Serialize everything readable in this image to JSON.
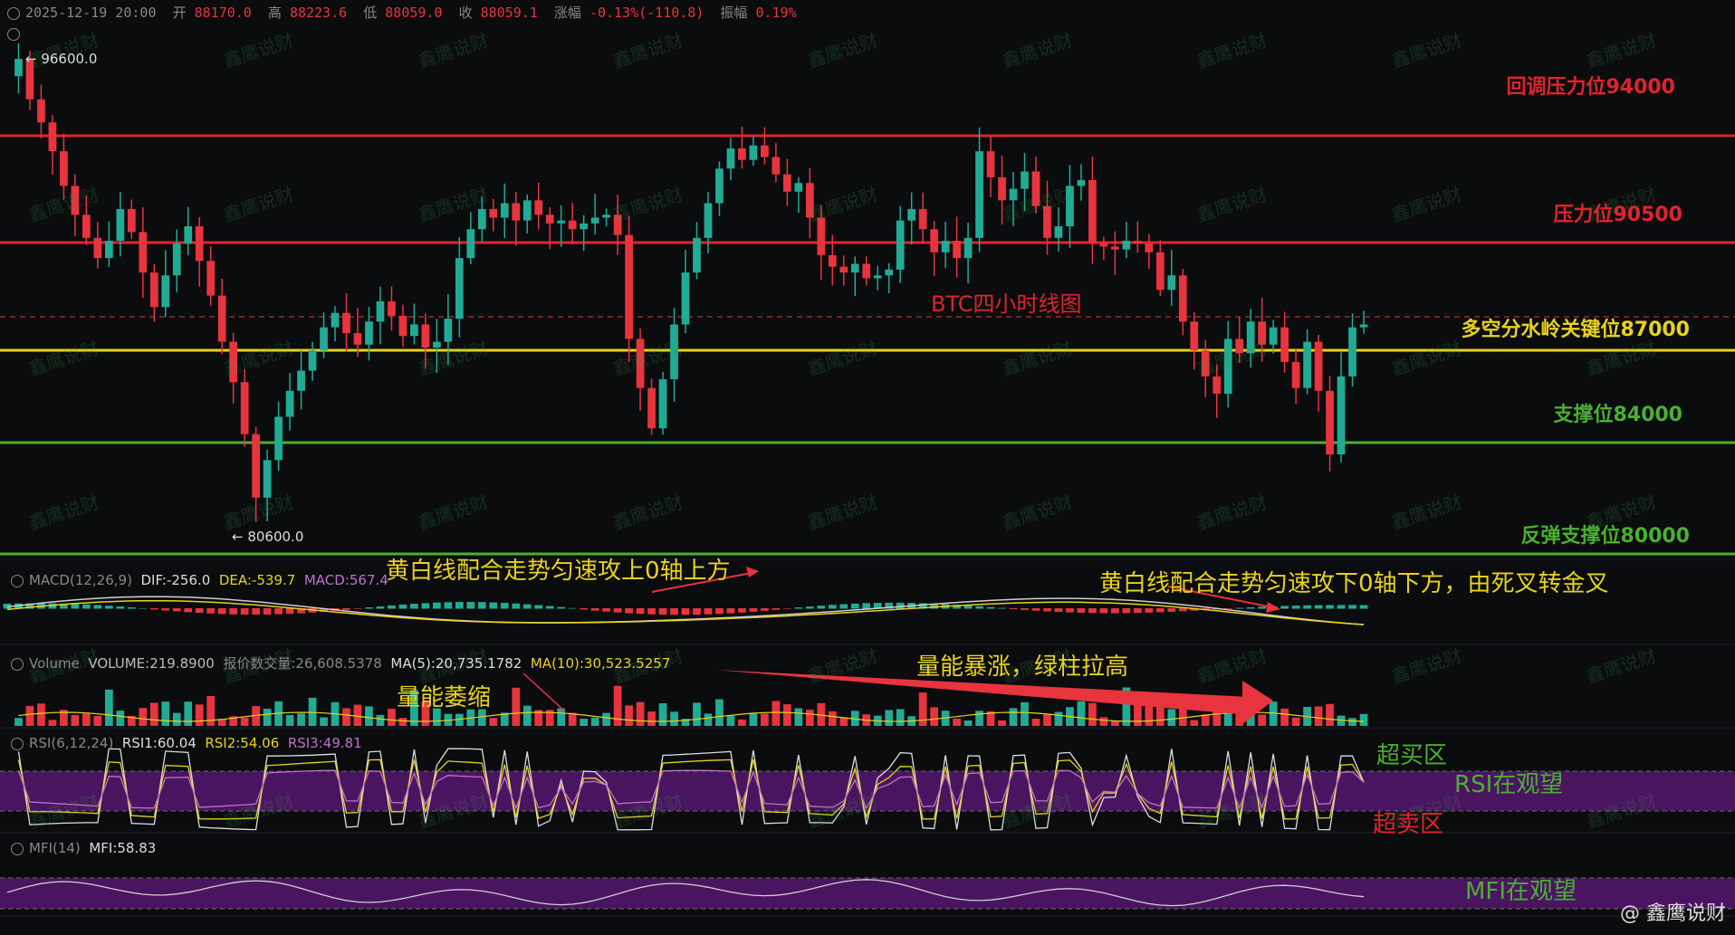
{
  "header": {
    "datetime": "2025-12-19 20:00",
    "open_label": "开",
    "open": "88170.0",
    "high_label": "高",
    "high": "88223.6",
    "low_label": "低",
    "low": "88059.0",
    "close_label": "收",
    "close": "88059.1",
    "change_label": "涨幅",
    "change": "-0.13%(-110.8)",
    "amplitude_label": "振幅",
    "amplitude": "0.19%"
  },
  "price_marks": {
    "high": "← 96600.0",
    "low": "← 80600.0"
  },
  "levels": [
    {
      "label": "回调压力位94000",
      "price": 94000,
      "color": "#e0242c",
      "style": "solid"
    },
    {
      "label": "压力位90500",
      "price": 90500,
      "color": "#e0242c",
      "style": "solid"
    },
    {
      "label": "多空分水岭关键位87000",
      "price": 87000,
      "color": "#e8d21d",
      "style": "solid"
    },
    {
      "label": "支撑位84000",
      "price": 84000,
      "color": "#49b030",
      "style": "solid"
    },
    {
      "label": "反弹支撑位80000",
      "price": 80000,
      "color": "#49b030",
      "style": "solid"
    }
  ],
  "chart_title": "BTC四小时线图",
  "macd": {
    "label": "MACD(12,26,9)",
    "dif": "DIF:-256.0",
    "dea": "DEA:-539.7",
    "macd": "MACD:567.4"
  },
  "volume": {
    "label": "Volume",
    "vol": "VOLUME:219.8900",
    "quote": "报价数交量:26,608.5378",
    "ma5": "MA(5):20,735.1782",
    "ma10": "MA(10):30,523.5257"
  },
  "rsi": {
    "label": "RSI(6,12,24)",
    "rsi1": "RSI1:60.04",
    "rsi2": "RSI2:54.06",
    "rsi3": "RSI3:49.81"
  },
  "mfi": {
    "label": "MFI(14)",
    "value": "MFI:58.83"
  },
  "annotations": {
    "macd_left": "黄白线配合走势匀速攻上0轴上方",
    "macd_right": "黄白线配合走势匀速攻下0轴下方，由死叉转金叉",
    "vol_left": "量能萎缩",
    "vol_right": "量能暴涨，绿柱拉高",
    "overbought": "超买区",
    "rsi_watch": "RSI在观望",
    "oversold": "超卖区",
    "mfi_watch": "MFI在观望"
  },
  "watermark": "鑫鹰说财",
  "source_tag": "@ 鑫鹰说财",
  "colors": {
    "up": "#22ab94",
    "down": "#e8343e",
    "bg": "#0b0c0e",
    "band": "#4a1560"
  },
  "chart_data": {
    "type": "candlestick",
    "title": "BTC四小时线图",
    "ylim": [
      79500,
      97500
    ],
    "close_path": [
      95800,
      96400,
      95000,
      94200,
      93200,
      92000,
      91000,
      90200,
      89500,
      90100,
      91200,
      90400,
      89000,
      87800,
      88900,
      90000,
      90600,
      89400,
      88200,
      86600,
      85200,
      83400,
      81200,
      82500,
      84000,
      84900,
      85600,
      86300,
      87100,
      87600,
      86900,
      86500,
      87300,
      88000,
      87500,
      86800,
      87200,
      86400,
      86600,
      87400,
      89500,
      90500,
      91200,
      90900,
      91400,
      90800,
      91500,
      91000,
      90700,
      90800,
      90500,
      90700,
      90900,
      91000,
      90300,
      86700,
      85000,
      83600,
      85300,
      87200,
      89000,
      90200,
      91400,
      92600,
      93300,
      92900,
      93400,
      93000,
      92400,
      91800,
      92100,
      90900,
      89600,
      89200,
      89000,
      89300,
      88800,
      88900,
      89100,
      90800,
      91200,
      90500,
      89700,
      90100,
      89500,
      90200,
      93200,
      92300,
      91500,
      91900,
      92500,
      91300,
      90200,
      90600,
      92000,
      92200,
      90000,
      89900,
      89800,
      90100,
      90000,
      89700,
      88400,
      88900,
      87300,
      86300,
      85400,
      84800,
      86700,
      86200,
      87300,
      86500,
      87100,
      85900,
      85000,
      86600,
      84900,
      82700,
      85400,
      87100,
      87200
    ]
  }
}
